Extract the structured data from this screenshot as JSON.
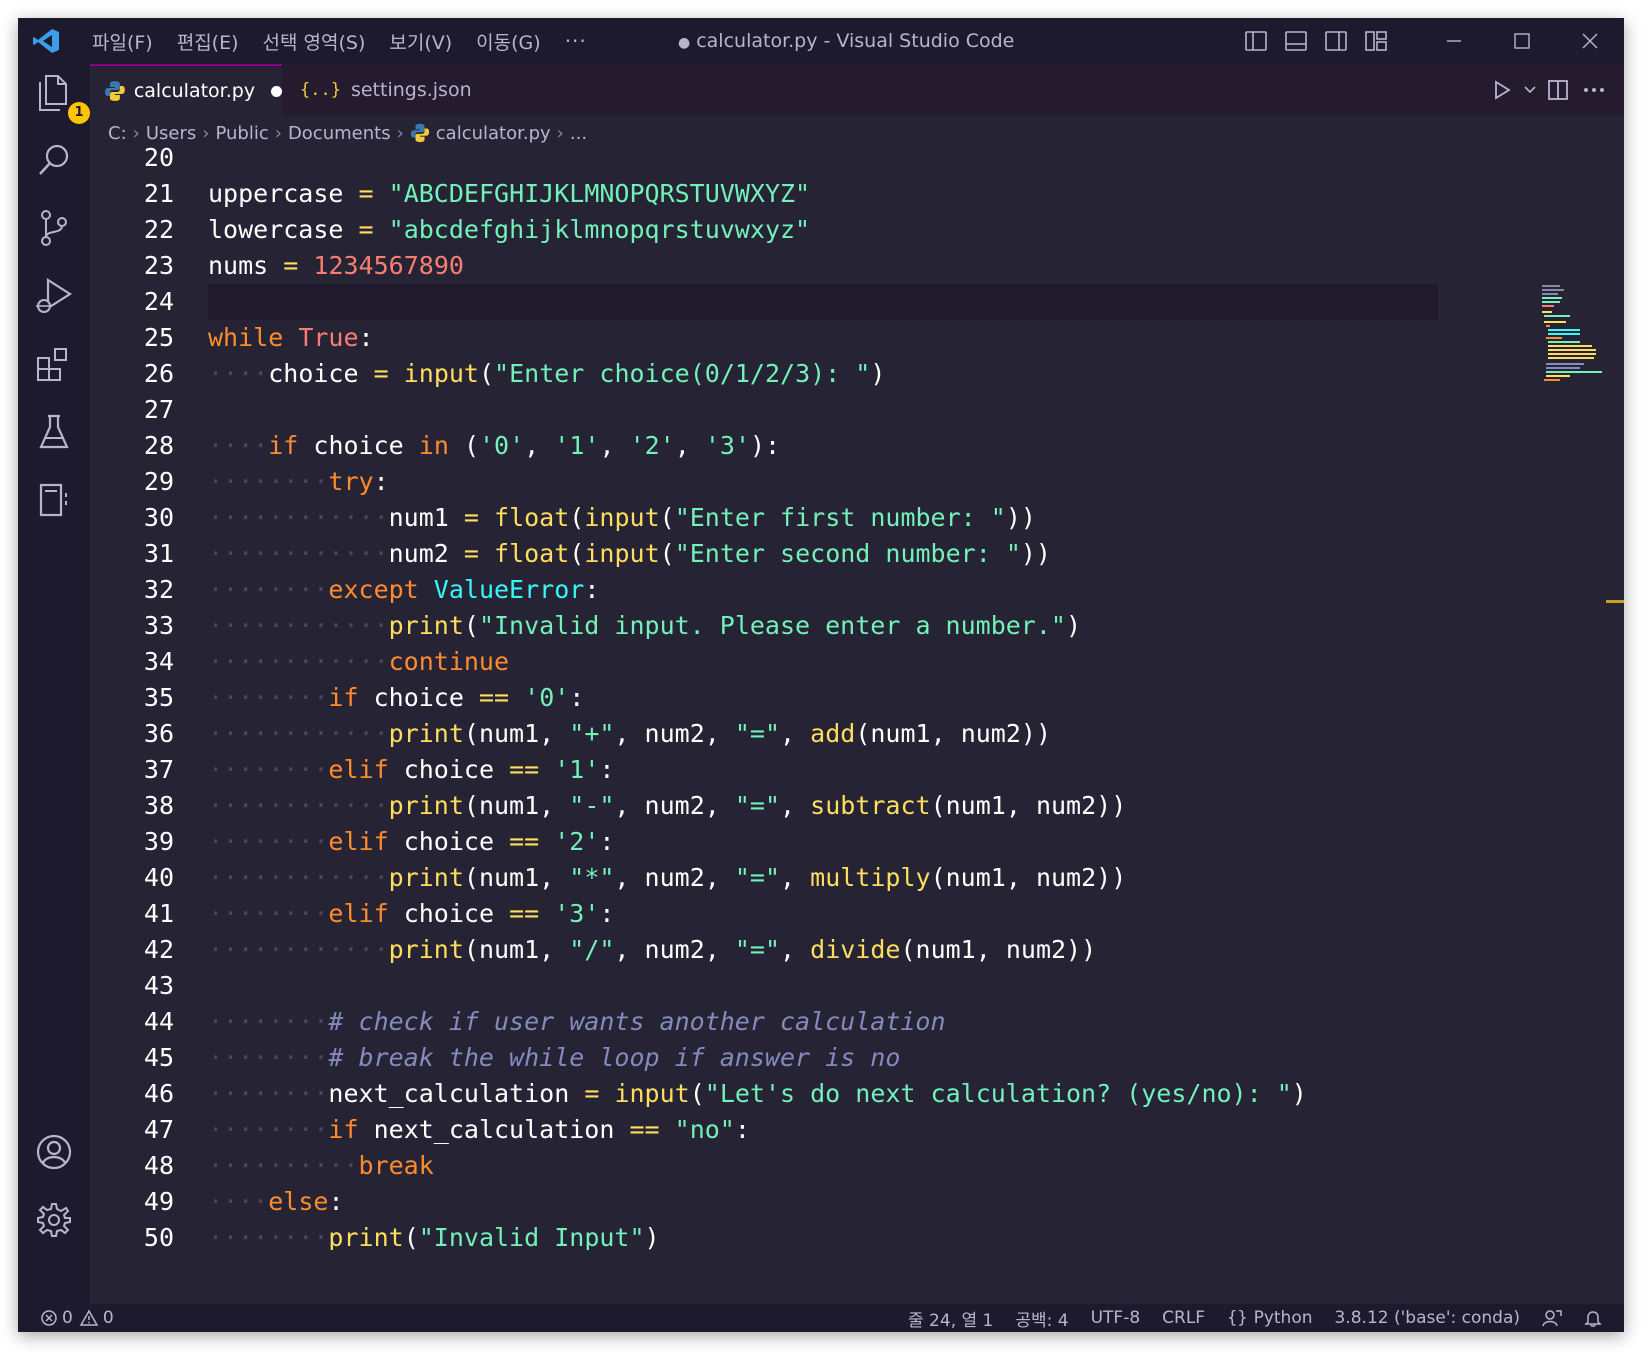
{
  "titlebar": {
    "menus": [
      "파일(F)",
      "편집(E)",
      "선택 영역(S)",
      "보기(V)",
      "이동(G)"
    ],
    "more": "···",
    "title": "calculator.py - Visual Studio Code",
    "modified_dot": "●"
  },
  "activity": {
    "explorer_badge": "1"
  },
  "tabs": [
    {
      "label": "calculator.py",
      "icon": "python-icon"
    },
    {
      "label": "settings.json",
      "icon": "json-braces-icon"
    }
  ],
  "breadcrumb": [
    "C:",
    "Users",
    "Public",
    "Documents",
    "calculator.py",
    "..."
  ],
  "editor": {
    "lines": [
      {
        "n": "20",
        "code": ""
      },
      {
        "n": "21",
        "code": "uppercase = \"ABCDEFGHIJKLMNOPQRSTUVWXYZ\""
      },
      {
        "n": "22",
        "code": "lowercase = \"abcdefghijklmnopqrstuvwxyz\""
      },
      {
        "n": "23",
        "code": "nums = 1234567890"
      },
      {
        "n": "24",
        "code": ""
      },
      {
        "n": "25",
        "code": "while True:"
      },
      {
        "n": "26",
        "code": "    choice = input(\"Enter choice(0/1/2/3): \")"
      },
      {
        "n": "27",
        "code": ""
      },
      {
        "n": "28",
        "code": "    if choice in ('0', '1', '2', '3'):"
      },
      {
        "n": "29",
        "code": "        try:"
      },
      {
        "n": "30",
        "code": "            num1 = float(input(\"Enter first number: \"))"
      },
      {
        "n": "31",
        "code": "            num2 = float(input(\"Enter second number: \"))"
      },
      {
        "n": "32",
        "code": "        except ValueError:"
      },
      {
        "n": "33",
        "code": "            print(\"Invalid input. Please enter a number.\")"
      },
      {
        "n": "34",
        "code": "            continue"
      },
      {
        "n": "35",
        "code": "        if choice == '0':"
      },
      {
        "n": "36",
        "code": "            print(num1, \"+\", num2, \"=\", add(num1, num2))"
      },
      {
        "n": "37",
        "code": "        elif choice == '1':"
      },
      {
        "n": "38",
        "code": "            print(num1, \"-\", num2, \"=\", subtract(num1, num2))"
      },
      {
        "n": "39",
        "code": "        elif choice == '2':"
      },
      {
        "n": "40",
        "code": "            print(num1, \"*\", num2, \"=\", multiply(num1, num2))"
      },
      {
        "n": "41",
        "code": "        elif choice == '3':"
      },
      {
        "n": "42",
        "code": "            print(num1, \"/\", num2, \"=\", divide(num1, num2))"
      },
      {
        "n": "43",
        "code": ""
      },
      {
        "n": "44",
        "code": "        # check if user wants another calculation"
      },
      {
        "n": "45",
        "code": "        # break the while loop if answer is no"
      },
      {
        "n": "46",
        "code": "        next_calculation = input(\"Let's do next calculation? (yes/no): \")"
      },
      {
        "n": "47",
        "code": "        if next_calculation == \"no\":"
      },
      {
        "n": "48",
        "code": "          break"
      },
      {
        "n": "49",
        "code": "    else:"
      },
      {
        "n": "50",
        "code": "        print(\"Invalid Input\")"
      }
    ],
    "current_line": "24"
  },
  "statusbar": {
    "errors": "0",
    "warnings": "0",
    "position": "줄 24, 열 1",
    "indent": "공백: 4",
    "encoding": "UTF-8",
    "eol": "CRLF",
    "language": "Python",
    "interpreter": "3.8.12 ('base': conda)"
  },
  "colors": {
    "background": "#262335",
    "titlebar": "#1e1a2e",
    "keyword": "#fede5d",
    "string": "#ff8b39",
    "number": "#f97e72",
    "function": "#36f9f6",
    "comment": "#848bbd",
    "badge": "#ffc600"
  }
}
